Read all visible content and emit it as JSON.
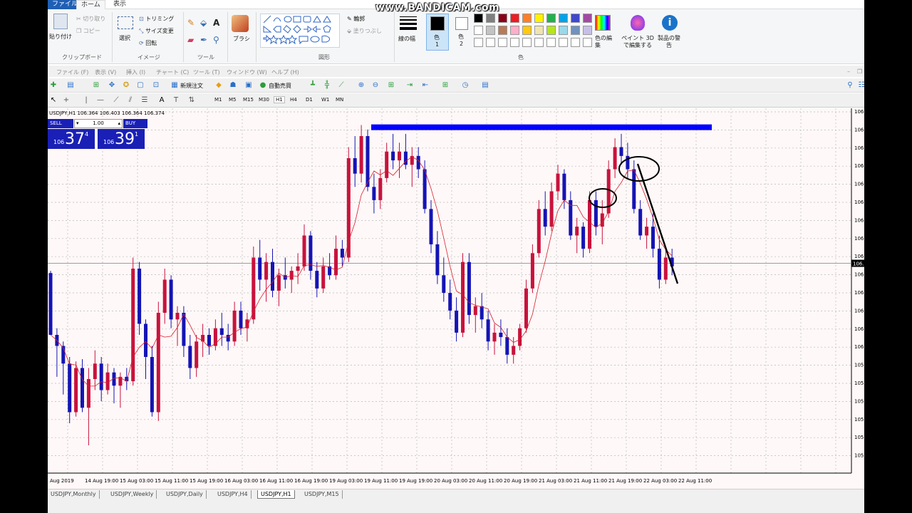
{
  "watermark": "www.BANDICAM.com",
  "paint": {
    "tabs": [
      "ファイル",
      "ホーム",
      "表示"
    ],
    "clipboard": {
      "paste": "貼り付け",
      "cut": "切り取り",
      "copy": "コピー",
      "label": "クリップボード"
    },
    "image": {
      "select": "選択",
      "crop": "トリミング",
      "resize": "サイズ変更",
      "rotate": "回転",
      "label": "イメージ"
    },
    "tools": {
      "label": "ツール"
    },
    "brush": {
      "label": "ブラシ"
    },
    "shapes": {
      "outline": "輪郭",
      "fill": "塗りつぶし",
      "label": "図形"
    },
    "size": {
      "label": "線の幅"
    },
    "color1": {
      "label": "色",
      "num": "1"
    },
    "color2": {
      "label": "色",
      "num": "2"
    },
    "colors": {
      "label": "色",
      "edit": "色の編集",
      "paint3d": "ペイント 3D で編集する",
      "notice": "製品の警告"
    },
    "palette": [
      "#000000",
      "#7f7f7f",
      "#880015",
      "#ed1c24",
      "#ff7f27",
      "#fff200",
      "#22b14c",
      "#00a2e8",
      "#3f48cc",
      "#a349a4",
      "#ffffff",
      "#c3c3c3",
      "#b97a57",
      "#ffaec9",
      "#ffc90e",
      "#efe4b0",
      "#b5e61d",
      "#99d9ea",
      "#7092be",
      "#c8bfe7"
    ]
  },
  "mt4": {
    "menu": [
      "ファイル (F)",
      "表示 (V)",
      "挿入 (I)",
      "チャート (C)",
      "ツール (T)",
      "ウィンドウ (W)",
      "ヘルプ (H)"
    ],
    "toolbar": {
      "new_order": "新規注文",
      "autotrade": "自動売買"
    },
    "timeframes": [
      "M1",
      "M5",
      "M15",
      "M30",
      "H1",
      "H4",
      "D1",
      "W1",
      "MN"
    ],
    "active_timeframe": "H1",
    "symbol_line": "USDJPY,H1  106.364 106.403 106.364 106.374",
    "oneclick": {
      "sell": "SELL",
      "buy": "BUY",
      "lot": "1.00",
      "sell_small": "106",
      "sell_big": "37",
      "sell_sup": "4",
      "buy_small": "106",
      "buy_big": "39",
      "buy_sup": "1"
    },
    "chart_tabs": [
      "USDJPY,Monthly",
      "USDJPY,Weekly",
      "USDJPY,Daily",
      "USDJPY,H4",
      "USDJPY,H1",
      "USDJPY,M15"
    ],
    "active_chart_tab": "USDJPY,H1"
  },
  "chart_data": {
    "type": "candlestick",
    "symbol": "USDJPY",
    "timeframe": "H1",
    "x_labels": [
      "Aug 2019",
      "14 Aug 19:00",
      "15 Aug 03:00",
      "15 Aug 11:00",
      "15 Aug 19:00",
      "16 Aug 03:00",
      "16 Aug 11:00",
      "16 Aug 19:00",
      "19 Aug 03:00",
      "19 Aug 11:00",
      "19 Aug 19:00",
      "20 Aug 03:00",
      "20 Aug 11:00",
      "20 Aug 19:00",
      "21 Aug 03:00",
      "21 Aug 11:00",
      "21 Aug 19:00",
      "22 Aug 03:00",
      "22 Aug 11:00"
    ],
    "y_tick_label": "106.",
    "y_tick_labels": [
      "106.",
      "106.",
      "106.",
      "106.",
      "106.",
      "106.",
      "106.",
      "106.",
      "106.",
      "106.",
      "106.",
      "106.",
      "106.",
      "106.",
      "105.",
      "105.",
      "105.",
      "105.",
      "105.",
      "105."
    ],
    "current_price_label": "106.",
    "grid": true,
    "bull_color": "#c8123c",
    "bear_color": "#1414b4",
    "ma_color": "#d61f2b",
    "price_line": 106.374,
    "candles": [
      [
        106.33,
        106.34,
        106.05,
        106.05
      ],
      [
        106.05,
        106.08,
        105.86,
        106.0
      ],
      [
        106.0,
        106.02,
        105.78,
        105.92
      ],
      [
        105.92,
        105.95,
        105.65,
        105.7
      ],
      [
        105.7,
        105.93,
        105.68,
        105.9
      ],
      [
        105.9,
        105.94,
        105.7,
        105.72
      ],
      [
        105.72,
        105.9,
        105.55,
        105.85
      ],
      [
        105.85,
        105.98,
        105.8,
        105.92
      ],
      [
        105.92,
        105.95,
        105.75,
        105.8
      ],
      [
        105.8,
        105.92,
        105.78,
        105.88
      ],
      [
        105.88,
        105.9,
        105.74,
        105.82
      ],
      [
        105.82,
        105.88,
        105.72,
        105.86
      ],
      [
        105.86,
        105.9,
        105.8,
        105.84
      ],
      [
        105.84,
        106.4,
        105.82,
        106.35
      ],
      [
        106.35,
        106.38,
        106.05,
        106.1
      ],
      [
        106.1,
        106.12,
        105.85,
        105.95
      ],
      [
        105.95,
        106.0,
        105.68,
        105.7
      ],
      [
        105.7,
        106.2,
        105.66,
        106.15
      ],
      [
        106.15,
        106.35,
        106.1,
        106.3
      ],
      [
        106.3,
        106.32,
        106.08,
        106.12
      ],
      [
        106.12,
        106.18,
        106.0,
        106.15
      ],
      [
        106.15,
        106.18,
        105.95,
        106.0
      ],
      [
        106.0,
        106.05,
        105.85,
        105.9
      ],
      [
        105.9,
        106.05,
        105.86,
        106.02
      ],
      [
        106.02,
        106.1,
        105.95,
        106.05
      ],
      [
        106.05,
        106.08,
        105.96,
        106.0
      ],
      [
        106.0,
        106.12,
        105.98,
        106.08
      ],
      [
        106.08,
        106.15,
        106.0,
        106.05
      ],
      [
        106.05,
        106.1,
        105.98,
        106.02
      ],
      [
        106.02,
        106.2,
        106.0,
        106.16
      ],
      [
        106.16,
        106.2,
        106.05,
        106.08
      ],
      [
        106.08,
        106.15,
        106.02,
        106.12
      ],
      [
        106.12,
        106.45,
        106.1,
        106.4
      ],
      [
        106.4,
        106.48,
        106.25,
        106.3
      ],
      [
        106.3,
        106.42,
        106.2,
        106.38
      ],
      [
        106.38,
        106.44,
        106.22,
        106.25
      ],
      [
        106.25,
        106.35,
        106.18,
        106.32
      ],
      [
        106.32,
        106.4,
        106.26,
        106.3
      ],
      [
        106.3,
        106.36,
        106.24,
        106.34
      ],
      [
        106.34,
        106.42,
        106.28,
        106.36
      ],
      [
        106.36,
        106.55,
        106.34,
        106.5
      ],
      [
        106.5,
        106.52,
        106.3,
        106.34
      ],
      [
        106.34,
        106.38,
        106.22,
        106.26
      ],
      [
        106.26,
        106.4,
        106.24,
        106.36
      ],
      [
        106.36,
        106.42,
        106.3,
        106.32
      ],
      [
        106.32,
        106.5,
        106.3,
        106.44
      ],
      [
        106.44,
        106.48,
        106.36,
        106.4
      ],
      [
        106.4,
        106.9,
        106.38,
        106.85
      ],
      [
        106.85,
        106.95,
        106.72,
        106.78
      ],
      [
        106.78,
        107.0,
        106.74,
        106.95
      ],
      [
        106.95,
        106.98,
        106.7,
        106.72
      ],
      [
        106.72,
        106.78,
        106.6,
        106.66
      ],
      [
        106.66,
        106.8,
        106.62,
        106.76
      ],
      [
        106.76,
        106.92,
        106.74,
        106.88
      ],
      [
        106.88,
        106.96,
        106.8,
        106.84
      ],
      [
        106.84,
        106.92,
        106.76,
        106.88
      ],
      [
        106.88,
        106.96,
        106.8,
        106.82
      ],
      [
        106.82,
        106.9,
        106.72,
        106.86
      ],
      [
        106.86,
        106.9,
        106.76,
        106.8
      ],
      [
        106.8,
        106.84,
        106.6,
        106.62
      ],
      [
        106.62,
        106.66,
        106.42,
        106.46
      ],
      [
        106.46,
        106.52,
        106.28,
        106.32
      ],
      [
        106.32,
        106.4,
        106.2,
        106.24
      ],
      [
        106.24,
        106.3,
        106.12,
        106.16
      ],
      [
        106.16,
        106.22,
        106.02,
        106.06
      ],
      [
        106.06,
        106.42,
        106.04,
        106.38
      ],
      [
        106.38,
        106.42,
        106.1,
        106.14
      ],
      [
        106.14,
        106.22,
        106.06,
        106.18
      ],
      [
        106.18,
        106.24,
        106.08,
        106.12
      ],
      [
        106.12,
        106.16,
        105.98,
        106.02
      ],
      [
        106.02,
        106.1,
        105.96,
        106.06
      ],
      [
        106.06,
        106.12,
        106.0,
        106.04
      ],
      [
        106.04,
        106.08,
        105.92,
        105.96
      ],
      [
        105.96,
        106.04,
        105.92,
        106.0
      ],
      [
        106.0,
        106.1,
        105.98,
        106.08
      ],
      [
        106.08,
        106.3,
        106.06,
        106.26
      ],
      [
        106.26,
        106.46,
        106.24,
        106.42
      ],
      [
        106.42,
        106.66,
        106.4,
        106.62
      ],
      [
        106.62,
        106.7,
        106.5,
        106.54
      ],
      [
        106.54,
        106.74,
        106.52,
        106.7
      ],
      [
        106.7,
        106.82,
        106.66,
        106.78
      ],
      [
        106.78,
        106.8,
        106.62,
        106.66
      ],
      [
        106.66,
        106.7,
        106.48,
        106.5
      ],
      [
        106.5,
        106.58,
        106.42,
        106.54
      ],
      [
        106.54,
        106.56,
        106.4,
        106.44
      ],
      [
        106.44,
        106.7,
        106.42,
        106.66
      ],
      [
        106.66,
        106.7,
        106.5,
        106.54
      ],
      [
        106.54,
        106.66,
        106.46,
        106.6
      ],
      [
        106.6,
        106.84,
        106.58,
        106.8
      ],
      [
        106.8,
        106.94,
        106.76,
        106.9
      ],
      [
        106.9,
        106.96,
        106.82,
        106.86
      ],
      [
        106.86,
        106.92,
        106.76,
        106.8
      ],
      [
        106.8,
        106.84,
        106.6,
        106.62
      ],
      [
        106.62,
        106.66,
        106.48,
        106.5
      ],
      [
        106.5,
        106.58,
        106.44,
        106.54
      ],
      [
        106.54,
        106.6,
        106.4,
        106.44
      ],
      [
        106.44,
        106.5,
        106.26,
        106.3
      ],
      [
        106.3,
        106.44,
        106.28,
        106.4
      ],
      [
        106.4,
        106.44,
        106.32,
        106.36
      ]
    ],
    "annotations": {
      "horizontal_bar": {
        "color": "#0000ff",
        "price": 106.99
      },
      "ellipses": 2,
      "trend_line": {
        "color": "#000000"
      }
    }
  }
}
